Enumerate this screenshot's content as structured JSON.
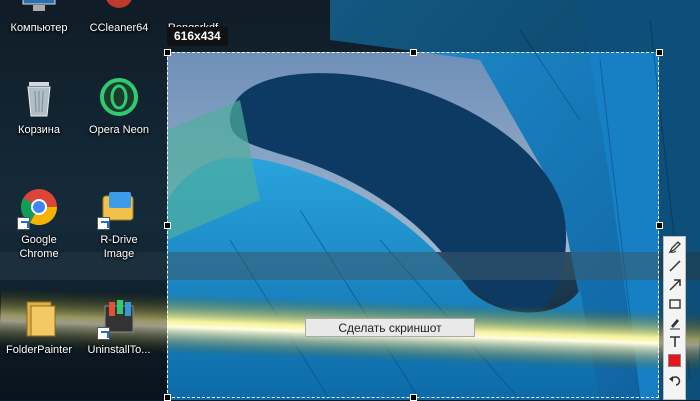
{
  "desktop": {
    "icons": [
      {
        "label": "Компьютер",
        "icon": "computer-icon"
      },
      {
        "label": "CCleaner64",
        "icon": "ccleaner-icon"
      },
      {
        "label": "Rengsrkdf",
        "icon": "app-icon"
      },
      {
        "label": "Корзина",
        "icon": "recycle-bin-icon"
      },
      {
        "label": "Opera Neon",
        "icon": "opera-neon-icon"
      },
      {
        "label": "Google Chrome",
        "icon": "chrome-icon"
      },
      {
        "label": "R-Drive Image",
        "icon": "r-drive-icon"
      },
      {
        "label": "FolderPainter",
        "icon": "folder-painter-icon"
      },
      {
        "label": "UninstallTo...",
        "icon": "uninstall-tool-icon"
      }
    ]
  },
  "selection": {
    "size_label": "616x434"
  },
  "capture_button": {
    "label": "Сделать скриншот"
  },
  "toolbar": {
    "tools": [
      "pen-icon",
      "line-icon",
      "arrow-icon",
      "rectangle-icon",
      "marker-icon",
      "text-icon",
      "color-swatch-icon",
      "undo-icon"
    ],
    "active_color": "#e8141c"
  }
}
